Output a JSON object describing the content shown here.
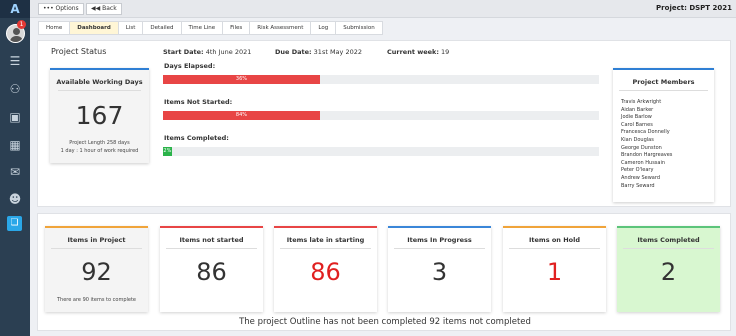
{
  "sidebar": {
    "logo": "A",
    "notifications": "1",
    "icons": [
      "menu-icon",
      "users-icon",
      "clipboard-icon",
      "calendar-icon",
      "mail-icon",
      "person-icon",
      "book-icon"
    ]
  },
  "topbar": {
    "options_label": "••• Options",
    "back_label": "◀◀ Back",
    "project_title": "Project: DSPT 2021"
  },
  "tabs": [
    {
      "label": "Home",
      "active": false
    },
    {
      "label": "Dashboard",
      "active": true
    },
    {
      "label": "List",
      "active": false
    },
    {
      "label": "Detailed",
      "active": false
    },
    {
      "label": "Time Line",
      "active": false
    },
    {
      "label": "Files",
      "active": false
    },
    {
      "label": "Risk Assessment",
      "active": false
    },
    {
      "label": "Log",
      "active": false
    },
    {
      "label": "Submission",
      "active": false
    }
  ],
  "status": {
    "title": "Project Status",
    "start_label": "Start Date:",
    "start_value": "4th June 2021",
    "due_label": "Due Date:",
    "due_value": "31st May 2022",
    "week_label": "Current week:",
    "week_value": "19"
  },
  "working_days": {
    "title": "Available Working Days",
    "value": "167",
    "sub1": "Project Length 258 days",
    "sub2": "1 day : 1 hour of work required"
  },
  "progress": [
    {
      "label": "Days Elapsed:",
      "value": 36,
      "text": "36%",
      "color": "#e84545"
    },
    {
      "label": "Items Not Started:",
      "value": 36,
      "text": "84%",
      "color": "#e84545"
    },
    {
      "label": "Items Completed:",
      "value": 2,
      "text": "2%",
      "color": "#2bb34a"
    }
  ],
  "members": {
    "title": "Project Members",
    "names": [
      "Travis Arkwright",
      "Aidan Barker",
      "Jodie Barlow",
      "Carol Barnes",
      "Francesca Donnelly",
      "Kian Douglas",
      "George Dunston",
      "Brandon Hargreaves",
      "Cameron Hussain",
      "Peter O'leary",
      "Andrew Seward",
      "Barry Seward"
    ]
  },
  "stats": [
    {
      "title": "Items in Project",
      "value": "92",
      "sub": "There are 90 items to complete",
      "accent": "#f0a43a",
      "value_color": "#333",
      "bg": "#f4f4f4"
    },
    {
      "title": "Items not started",
      "value": "86",
      "sub": "",
      "accent": "#e84545",
      "value_color": "#333",
      "bg": "#ffffff"
    },
    {
      "title": "Items late in starting",
      "value": "86",
      "sub": "",
      "accent": "#e84545",
      "value_color": "#e02020",
      "bg": "#ffffff"
    },
    {
      "title": "Items In Progress",
      "value": "3",
      "sub": "",
      "accent": "#3a86d8",
      "value_color": "#333",
      "bg": "#ffffff"
    },
    {
      "title": "Items on Hold",
      "value": "1",
      "sub": "",
      "accent": "#f0a43a",
      "value_color": "#e02020",
      "bg": "#ffffff"
    },
    {
      "title": "Items Completed",
      "value": "2",
      "sub": "",
      "accent": "#5cc47a",
      "value_color": "#333",
      "bg": "#d8f7d0"
    }
  ],
  "footer_note": "The project Outline has not been completed 92 items not completed"
}
